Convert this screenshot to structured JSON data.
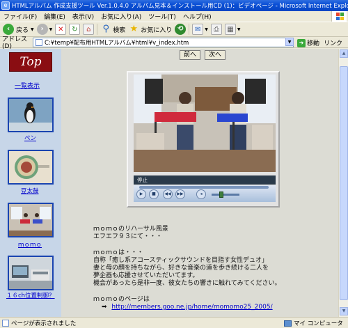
{
  "window": {
    "title": "HTMLアルバム 作成支援ツール Ver.1.0.4.0 アルバム見本＆インストール用CD (1)：ビデオページ - Microsoft Internet Explorer"
  },
  "menu": [
    "ファイル(F)",
    "編集(E)",
    "表示(V)",
    "お気に入り(A)",
    "ツール(T)",
    "ヘルプ(H)"
  ],
  "toolbar": {
    "back_label": "戻る",
    "search_label": "検索",
    "favorites_label": "お気に入り"
  },
  "address": {
    "label": "アドレス(D)",
    "value": "C:¥temp¥配布用HTMLアルバム¥html¥v_index.htm",
    "go_label": "移動",
    "links_label": "リンク"
  },
  "sidebar": {
    "logo_text": "Top",
    "index_link": "一覧表示",
    "items": [
      {
        "label": "ペン"
      },
      {
        "label": "豆太鼓"
      },
      {
        "label": "ｍｏｍｏ"
      },
      {
        "label": "１６ch位置制御？"
      }
    ]
  },
  "nav": {
    "prev": "前へ",
    "next": "次へ"
  },
  "player": {
    "status": "停止"
  },
  "description": {
    "line1": "ｍｏｍｏのリハーサル風景",
    "line2": "エフエフ９３にて・・・",
    "line3": "ｍｏｍｏは・・・",
    "line4": "自称「癒し系アコースティックサウンドを目指す女性デュオ」",
    "line5": "妻と母の顔を持ちながら、好きな音楽の道を歩き続ける二人を",
    "line6": "夢企画も応援させていただいてます。",
    "line7": "機会があったら是非一度、彼女たちの響きに触れてみてください。",
    "line8": "ｍｏｍｏのページは",
    "arrow": "➡",
    "url": "http://members.goo.ne.jp/home/momomo25_2005/"
  },
  "status": {
    "text": "ページが表示されました",
    "zone": "マイ コンピュータ"
  }
}
